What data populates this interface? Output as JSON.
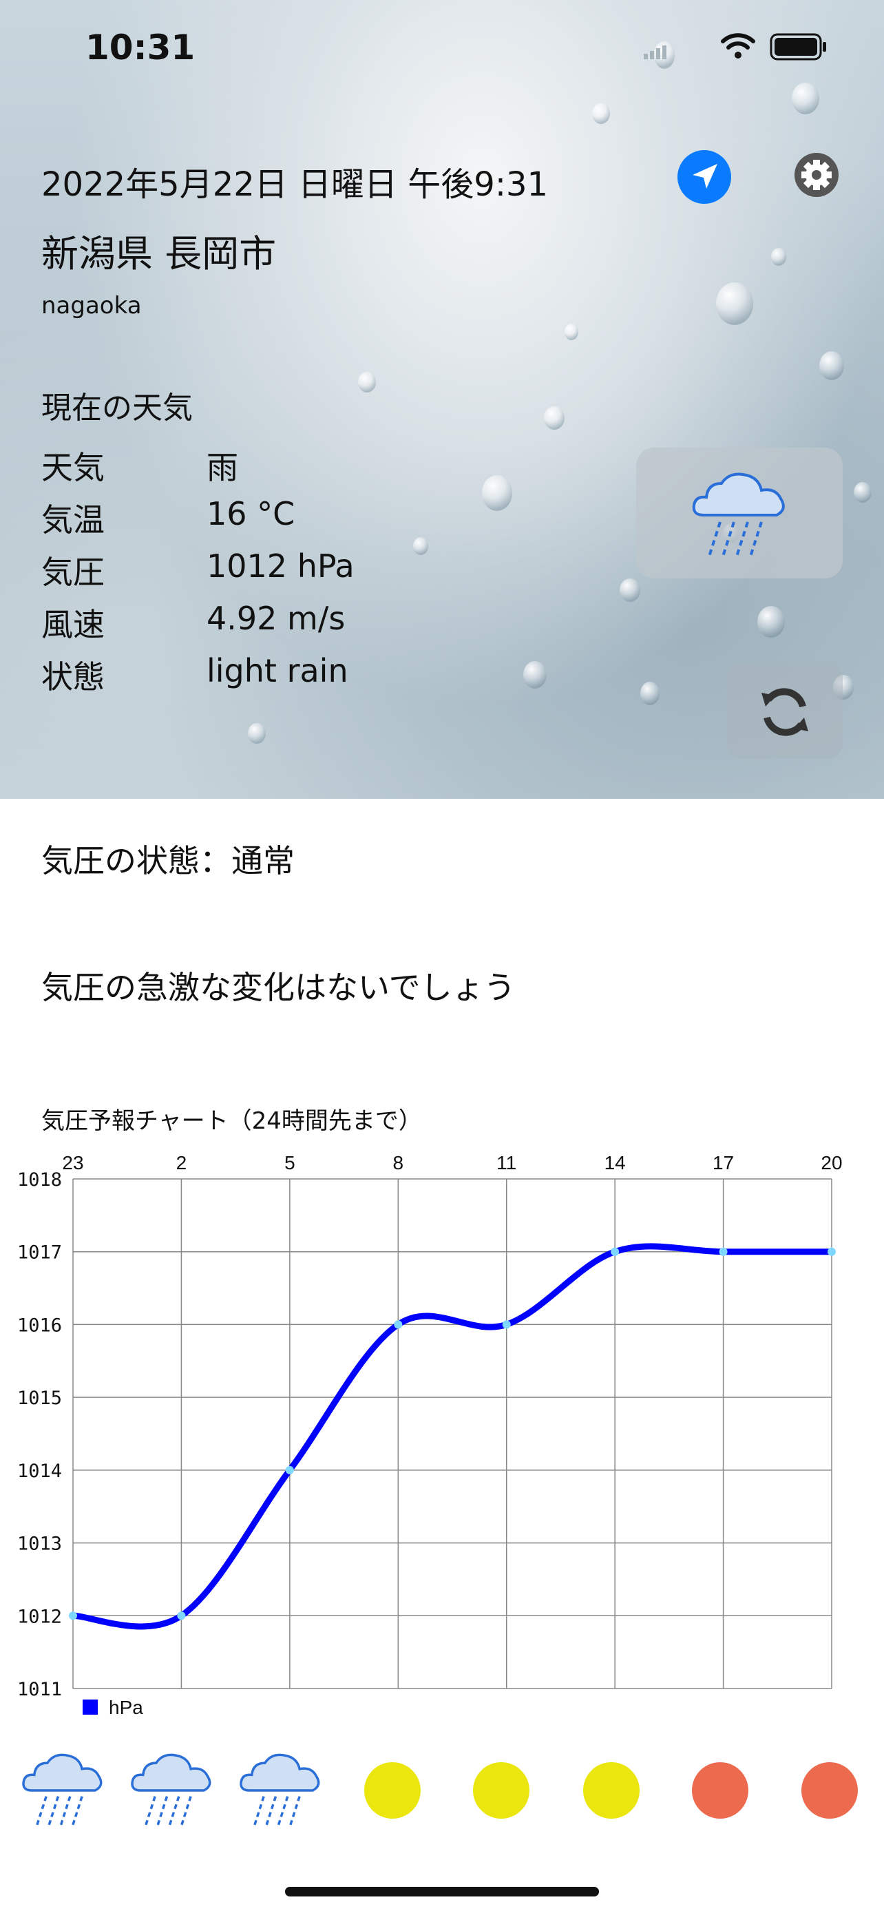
{
  "status_bar": {
    "time": "10:31"
  },
  "header": {
    "datetime": "2022年5月22日 日曜日 午後9:31",
    "city": "新潟県 長岡市",
    "city_romaji": "nagaoka"
  },
  "current": {
    "section_title": "現在の天気",
    "rows": [
      {
        "label": "天気",
        "value": "雨"
      },
      {
        "label": "気温",
        "value": "16 °C"
      },
      {
        "label": "気圧",
        "value": "1012 hPa"
      },
      {
        "label": "風速",
        "value": "4.92 m/s"
      },
      {
        "label": "状態",
        "value": "light rain"
      }
    ],
    "icon": "rain-cloud-icon"
  },
  "pressure": {
    "status": "気圧の状態：通常",
    "advice": "気圧の急激な変化はないでしょう"
  },
  "chart_data": {
    "type": "line",
    "title": "気圧予報チャート（24時間先まで）",
    "categories": [
      "23",
      "2",
      "5",
      "8",
      "11",
      "14",
      "17",
      "20"
    ],
    "series": [
      {
        "name": "hPa",
        "values": [
          1012,
          1012,
          1014,
          1016,
          1016,
          1017,
          1017,
          1017
        ],
        "color": "#0000ff"
      }
    ],
    "ylim": [
      1011,
      1018
    ],
    "yticks": [
      "1011",
      "1012",
      "1013",
      "1014",
      "1015",
      "1016",
      "1017",
      "1018"
    ],
    "grid": true,
    "legend": "bottom-left",
    "xaxis_position": "top"
  },
  "forecast_icons": [
    "rain-cloud-icon",
    "rain-cloud-icon",
    "rain-cloud-icon",
    "sun-yellow-icon",
    "sun-yellow-icon",
    "sun-yellow-icon",
    "sun-red-icon",
    "sun-red-icon"
  ],
  "colors": {
    "accent": "#0a7bff",
    "line": "#0000ff",
    "sun_yellow": "#eae60e",
    "sun_red": "#ec6b4f"
  }
}
